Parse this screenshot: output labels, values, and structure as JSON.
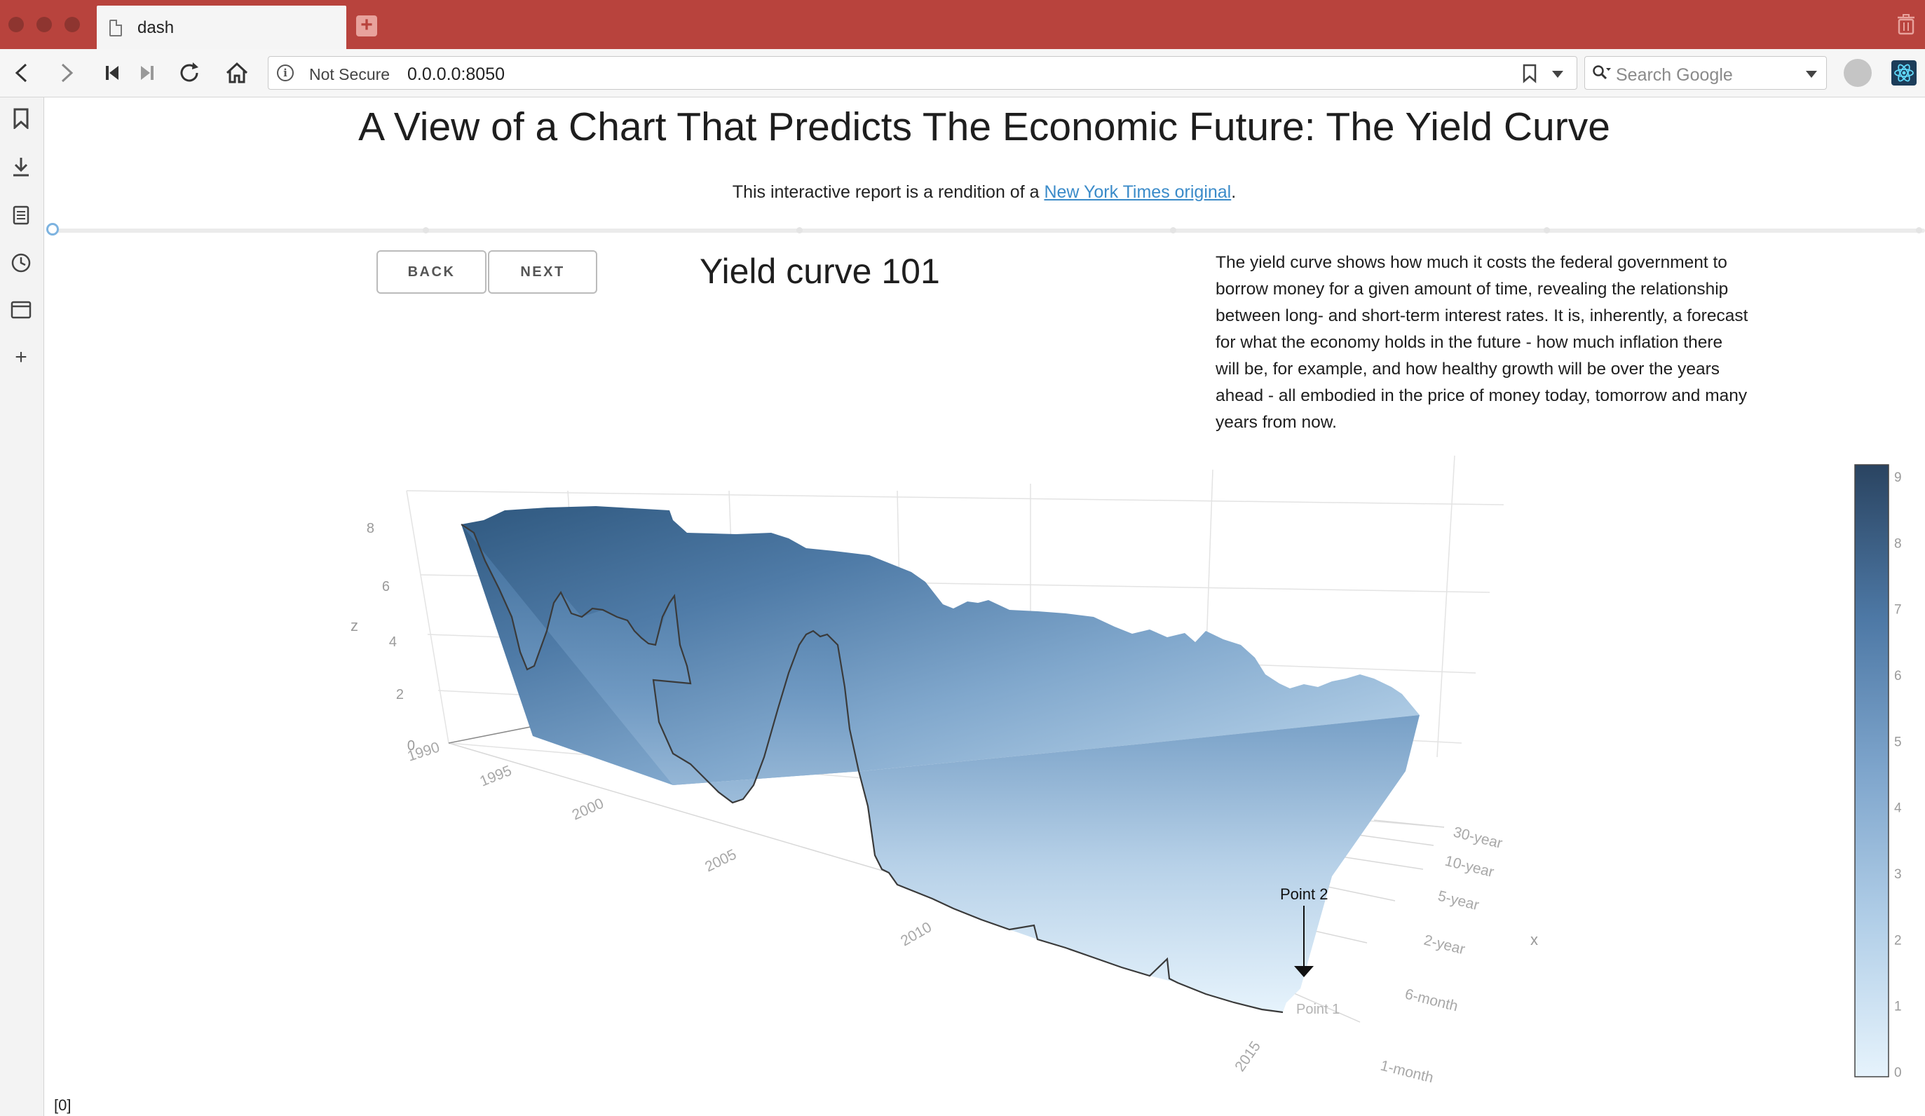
{
  "browser": {
    "tab_title": "dash",
    "security_label": "Not Secure",
    "url": "0.0.0.0:8050",
    "search_placeholder": "Search Google"
  },
  "page": {
    "title": "A View of a Chart That Predicts The Economic Future: The Yield Curve",
    "subtitle_prefix": "This interactive report is a rendition of a ",
    "subtitle_link": "New York Times original",
    "subtitle_suffix": ".",
    "back_label": "BACK",
    "next_label": "NEXT",
    "section_title": "Yield curve 101",
    "description": "The yield curve shows how much it costs the federal government to borrow money for a given amount of time, revealing the relationship between long- and short-term interest rates. It is, inherently, a forecast for what the economy holds in the future - how much inflation there will be, for example, and how healthy growth will be over the years ahead - all embodied in the price of money today, tomorrow and many years from now.",
    "footer": "[0]"
  },
  "chart_data": {
    "type": "surface",
    "z_axis_label": "z",
    "x_axis_label": "x",
    "z_ticks": [
      "0",
      "2",
      "4",
      "6",
      "8"
    ],
    "year_ticks": [
      "1990",
      "1995",
      "2000",
      "2005",
      "2010",
      "2015"
    ],
    "maturity_ticks": [
      "1-month",
      "6-month",
      "2-year",
      "5-year",
      "10-year",
      "30-year"
    ],
    "colorbar_ticks": [
      "0",
      "1",
      "2",
      "3",
      "4",
      "5",
      "6",
      "7",
      "8",
      "9"
    ],
    "colorscale": [
      "#e6f3fc",
      "#2a4461"
    ],
    "annotations": [
      {
        "text": "Point 2",
        "arrow": true
      },
      {
        "text": "Point 1",
        "arrow": false
      }
    ],
    "front_profile_1month": [
      {
        "year": 1990,
        "value": 8.0
      },
      {
        "year": 1991,
        "value": 5.6
      },
      {
        "year": 1992,
        "value": 3.3
      },
      {
        "year": 1993,
        "value": 3.0
      },
      {
        "year": 1994,
        "value": 4.5
      },
      {
        "year": 1995,
        "value": 5.5
      },
      {
        "year": 1996,
        "value": 5.0
      },
      {
        "year": 1997,
        "value": 5.1
      },
      {
        "year": 1998,
        "value": 4.8
      },
      {
        "year": 1999,
        "value": 4.8
      },
      {
        "year": 2000,
        "value": 6.0
      },
      {
        "year": 2001,
        "value": 2.5
      },
      {
        "year": 2002,
        "value": 1.7
      },
      {
        "year": 2003,
        "value": 1.0
      },
      {
        "year": 2004,
        "value": 1.5
      },
      {
        "year": 2005,
        "value": 3.2
      },
      {
        "year": 2006,
        "value": 4.8
      },
      {
        "year": 2007,
        "value": 4.5
      },
      {
        "year": 2008,
        "value": 1.0
      },
      {
        "year": 2009,
        "value": 0.1
      },
      {
        "year": 2012,
        "value": 0.05
      },
      {
        "year": 2015,
        "value": 0.02
      },
      {
        "year": 2017,
        "value": 0.9
      }
    ]
  }
}
